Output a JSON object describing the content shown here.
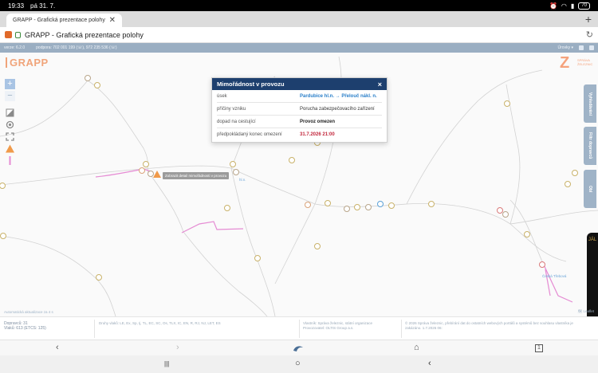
{
  "status": {
    "time": "19:33",
    "date": "pá 31. 7.",
    "battery": "70"
  },
  "browser": {
    "tab_title": "GRAPP - Grafická prezentace polohy",
    "tab_close": "✕",
    "new_tab": "+",
    "page_title": "GRAPP - Grafická prezentace polohy",
    "reload_icon": "↻"
  },
  "appbar": {
    "version": "verze: 6.2.0",
    "support": "podpora: 702 001 199 (☏), 972 235 536 (☏)",
    "menu_label": "Úrovky ▾"
  },
  "map": {
    "logo": "GRAPP",
    "sz_logo_text": "SPRÁVA\nŽELEZNIC",
    "zoom_in": "+",
    "zoom_out": "−",
    "side_tabs": [
      "Vyhledávání",
      "Filtr dopravců",
      "Obl"
    ],
    "dark_tab": "JÁL",
    "tooltip": "Zobrazit detail mimořádnosti v provozu",
    "place_labels": [
      "hl.n.",
      "Česká Třebová"
    ],
    "attribution_left": "Automatická aktualizace za 4 s",
    "attribution_right": "🗺 Leaflet"
  },
  "popup": {
    "title": "Mimořádnost v provozu",
    "close": "×",
    "rows": [
      {
        "label": "úsek",
        "value": "Pardubice hl.n. → Přelouč nákl. n."
      },
      {
        "label": "příčiny vzniku",
        "value": "Porucha zabezpečovacího zařízení"
      },
      {
        "label": "dopad na cestující",
        "value": "Provoz omezen"
      },
      {
        "label": "předpokládaný konec omezení",
        "value": "31.7.2026 21:00"
      }
    ]
  },
  "footer": {
    "counts_line1": "Dopravců: 31",
    "counts_line2": "Vlaků: 613 (ETCS: 125)",
    "train_types": "Druhy vlaků: LE, Ex, Sp, Ij, TL, EC, SC, Os, TLX, IC, EN, R, RJ, NJ, LET, ES",
    "owner": "Vlastník: Správa železnic, státní organizace\nProvozovatel: OLTIS Group a.s.",
    "copyright": "© 2026 Správa železnic, přebírání dat do ostatních webových portálů a systémů bez souhlasu vlastníka je zakázáno. 1.7.2026 06:"
  },
  "browser_nav": {
    "back": "‹",
    "forward": "›",
    "home": "⌂",
    "tabs": "1"
  },
  "android_nav": {
    "recents": "|||",
    "home": "○",
    "back": "‹"
  }
}
